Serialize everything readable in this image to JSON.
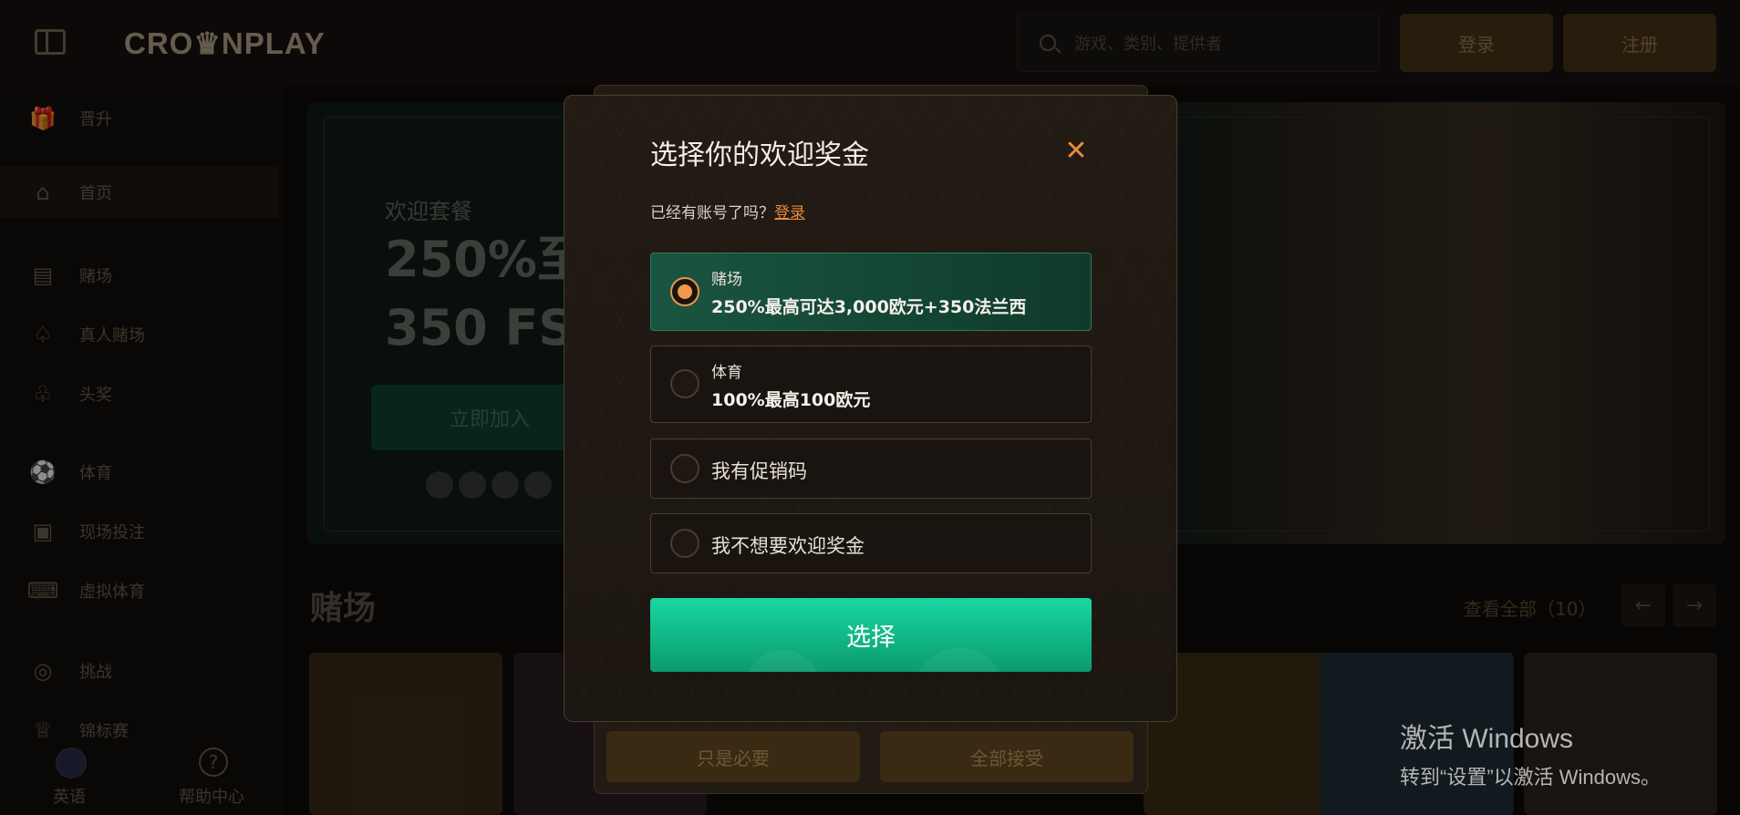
{
  "header": {
    "logo": "CRO♛NPLAY",
    "search_placeholder": "游戏、类别、提供者",
    "login_label": "登录",
    "register_label": "注册"
  },
  "sidebar": {
    "items": [
      {
        "label": "晋升",
        "icon": "gift-icon"
      },
      {
        "label": "首页",
        "icon": "home-icon"
      },
      {
        "label": "赌场",
        "icon": "slot-machine-icon"
      },
      {
        "label": "真人赌场",
        "icon": "spade-icon"
      },
      {
        "label": "头奖",
        "icon": "clover-icon"
      },
      {
        "label": "体育",
        "icon": "soccer-ball-icon"
      },
      {
        "label": "现场投注",
        "icon": "live-bet-icon"
      },
      {
        "label": "虚拟体育",
        "icon": "gamepad-icon"
      },
      {
        "label": "挑战",
        "icon": "medal-icon"
      },
      {
        "label": "锦标赛",
        "icon": "trophy-icon"
      }
    ],
    "language_label": "英语",
    "help_label": "帮助中心"
  },
  "hero": {
    "subtitle": "欢迎套餐",
    "title_line1": "250%至",
    "title_line2": "350 FS",
    "cta_label": "立即加入"
  },
  "casino_section": {
    "title": "赌场",
    "view_all": "查看全部（10）"
  },
  "cookie_panel": {
    "essential_label": "只是必要",
    "accept_all_label": "全部接受"
  },
  "modal": {
    "title": "选择你的欢迎奖金",
    "login_prompt": "已经有账号了吗？",
    "login_link": "登录",
    "options": [
      {
        "small": "赌场",
        "big": "250%最高可达3,000欧元+350法兰西",
        "selected": true
      },
      {
        "small": "体育",
        "big": "100%最高100欧元",
        "selected": false
      },
      {
        "label": "我有促销码",
        "selected": false
      },
      {
        "label": "我不想要欢迎奖金",
        "selected": false
      }
    ],
    "select_label": "选择"
  },
  "windows_watermark": {
    "title": "激活 Windows",
    "subtitle": "转到“设置”以激活 Windows。"
  },
  "colors": {
    "accent": "#e88a3a",
    "primary_green": "#12c48f",
    "selected_option_bg": "#1a5541"
  }
}
